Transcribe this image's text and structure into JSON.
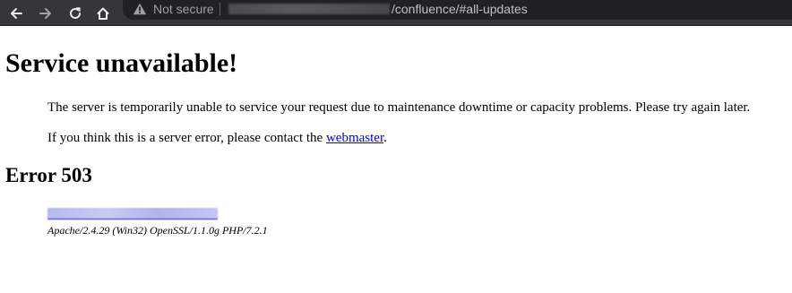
{
  "browser": {
    "security_label": "Not secure",
    "url_visible": "/confluence/#all-updates",
    "icons": {
      "back": "arrow-left-icon",
      "forward": "arrow-right-icon",
      "reload": "reload-icon",
      "home": "home-icon",
      "security": "warning-icon"
    },
    "colors": {
      "toolbar": "#35363a",
      "omnibox": "#202124",
      "icon": "#e8eaed",
      "icon_disabled": "#9aa0a6"
    }
  },
  "page": {
    "heading": "Service unavailable!",
    "message": "The server is temporarily unable to service your request due to maintenance downtime or capacity problems. Please try again later.",
    "contact_prefix": "If you think this is a server error, please contact the ",
    "contact_link": "webmaster",
    "contact_suffix": ".",
    "error_title": "Error 503",
    "server_signature": "Apache/2.4.29 (Win32) OpenSSL/1.1.0g PHP/7.2.1",
    "colors": {
      "link": "#0000ee",
      "text": "#000000"
    }
  }
}
